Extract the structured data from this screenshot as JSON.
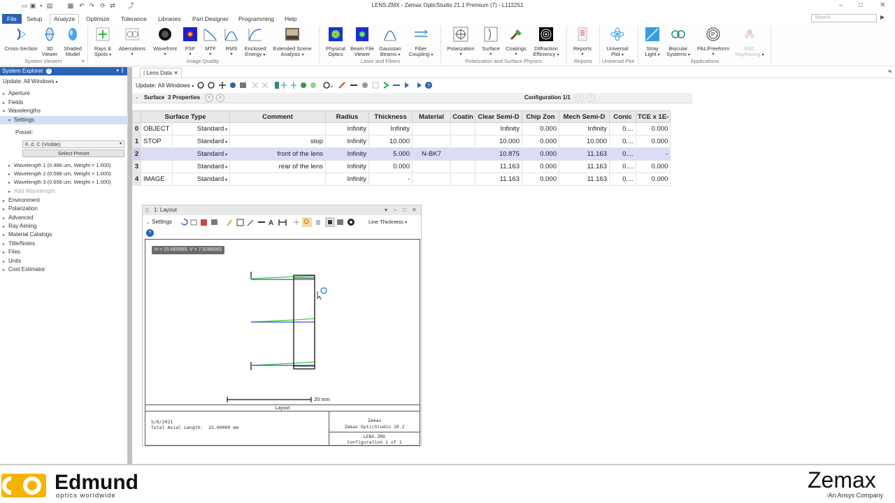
{
  "window": {
    "title": "LENS.ZMX - Zemax OpticStudio 21.1   Premium (7) - L112251",
    "search_placeholder": "Search..."
  },
  "tabs": [
    "File",
    "Setup",
    "Analyze",
    "Optimize",
    "Tolerance",
    "Libraries",
    "Part Designer",
    "Programming",
    "Help"
  ],
  "ribbon": {
    "cross_section": "Cross-Section",
    "three_d_1": "3D",
    "three_d_2": "Viewer",
    "shaded_1": "Shaded",
    "shaded_2": "Model",
    "rays_1": "Rays &",
    "rays_2": "Spots",
    "aberrations": "Aberrations",
    "wavefront": "Wavefront",
    "psf": "PSF",
    "mtf": "MTF",
    "rms": "RMS",
    "enclosed_1": "Enclosed",
    "enclosed_2": "Energy",
    "extended_1": "Extended Scene",
    "extended_2": "Analysis",
    "physical_1": "Physical",
    "physical_2": "Optics",
    "beamfile_1": "Beam File",
    "beamfile_2": "Viewer",
    "gaussian_1": "Gaussian",
    "gaussian_2": "Beams",
    "fiber_1": "Fiber",
    "fiber_2": "Coupling",
    "polarization": "Polarization",
    "surface": "Surface",
    "coatings": "Coatings",
    "diffraction_1": "Diffraction",
    "diffraction_2": "Efficiency",
    "reports": "Reports",
    "universal_1": "Universal",
    "universal_2": "Plot",
    "stray_1": "Stray",
    "stray_2": "Light",
    "biocular_1": "Biocular",
    "biocular_2": "Systems",
    "pal": "PAL/Freeform",
    "nsc_1": "NSC",
    "nsc_2": "Raytracing",
    "groups": {
      "system_viewers": "System Viewers",
      "image_quality": "Image Quality",
      "laser": "Laser and Fibers",
      "polarization": "Polarization and Surface Physics",
      "reports": "Reports",
      "universal": "Universal Plot",
      "applications": "Applications"
    }
  },
  "explorer": {
    "title": "System Explorer",
    "update": "Update: All Windows",
    "items": {
      "aperture": "Aperture",
      "fields": "Fields",
      "wavelengths": "Wavelengths",
      "settings": "Settings",
      "preset_label": "Preset:",
      "preset_value": "F, d, C (Visible)",
      "select_preset": "Select Preset",
      "wl1": "Wavelength 1 (0.486 um, Weight = 1.000)",
      "wl2": "Wavelength 2 (0.588 um, Weight = 1.000)",
      "wl3": "Wavelength 3 (0.656 um, Weight = 1.000)",
      "add_wl": "Add Wavelength",
      "environment": "Environment",
      "polarization": "Polarization",
      "advanced": "Advanced",
      "ray_aiming": "Ray Aiming",
      "material_catalogs": "Material Catalogs",
      "title_notes": "Title/Notes",
      "files": "Files",
      "units": "Units",
      "cost_estimator": "Cost Estimator"
    }
  },
  "lens_data": {
    "tab": "Lens Data",
    "update": "Update: All Windows",
    "surface_label": "Surface",
    "properties": "3 Properties",
    "configuration": "Configuration 1/1",
    "columns": [
      "Surface Type",
      "Comment",
      "Radius",
      "Thickness",
      "Material",
      "Coatin",
      "Clear Semi-D",
      "Chip Zon",
      "Mech Semi-D",
      "Conic",
      "TCE x 1E-"
    ],
    "rows": [
      {
        "idx": "0",
        "name": "OBJECT",
        "type": "Standard",
        "comment": "",
        "radius": "Infinity",
        "thickness": "Infinity",
        "material": "",
        "coating": "",
        "clear": "Infinity",
        "chip": "0.000",
        "mech": "Infinity",
        "conic": "0....",
        "tce": "0.000"
      },
      {
        "idx": "1",
        "name": "STOP",
        "type": "Standard",
        "comment": "stop",
        "radius": "Infinity",
        "thickness": "10.000",
        "material": "",
        "coating": "",
        "clear": "10.000",
        "chip": "0.000",
        "mech": "10.000",
        "conic": "0....",
        "tce": "0.000"
      },
      {
        "idx": "2",
        "name": "",
        "type": "Standard",
        "comment": "front of the lens",
        "radius": "Infinity",
        "thickness": "5.000",
        "material": "N-BK7",
        "coating": "",
        "clear": "10.875",
        "chip": "0.000",
        "mech": "11.163",
        "conic": "0....",
        "tce": "-"
      },
      {
        "idx": "3",
        "name": "",
        "type": "Standard",
        "comment": "rear of the lens",
        "radius": "Infinity",
        "thickness": "0.000",
        "material": "",
        "coating": "",
        "clear": "11.163",
        "chip": "0.000",
        "mech": "11.163",
        "conic": "0....",
        "tce": "0.000"
      },
      {
        "idx": "4",
        "name": "IMAGE",
        "type": "Standard",
        "comment": "",
        "radius": "Infinity",
        "thickness": "-",
        "material": "",
        "coating": "",
        "clear": "11.163",
        "chip": "0.000",
        "mech": "11.163",
        "conic": "0....",
        "tce": "0.000"
      }
    ]
  },
  "layout": {
    "title": "1: Layout",
    "settings": "Settings",
    "line_thickness": "Line Thickness",
    "coord": "H = 15.669989, V = 7.5286093",
    "scale": "20 mm",
    "caption": "Layout",
    "date": "5/6/2021",
    "axial": "Total Axial Length:",
    "axial_value": "15.00000 mm",
    "company": "Zemax",
    "product": "Zemax OpticStudio 20.2",
    "file": "LENS.ZMX",
    "config": "Configuration 1 of 1"
  },
  "branding": {
    "left_logo": "Edmund",
    "left_sub": "optics  worldwide",
    "right_logo": "Zemax",
    "right_sub": "An Ansys Company"
  },
  "colors": {
    "accent": "#2b62b3",
    "selected_row": "#dcdcf6",
    "ray_blue": "#3b4fd8",
    "ray_green": "#3ccf3c",
    "edmund_yellow": "#f5b400"
  }
}
